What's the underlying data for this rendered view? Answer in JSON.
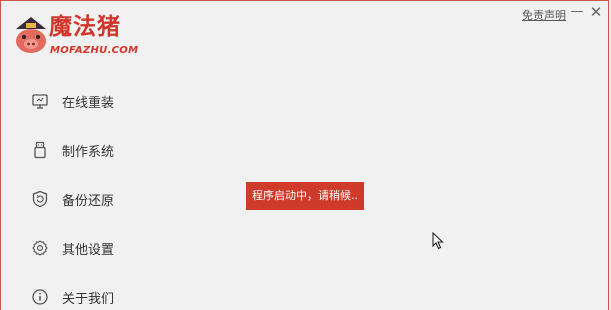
{
  "window": {
    "disclaimer_label": "免责声明",
    "minimize_glyph": "—",
    "close_glyph": "✕"
  },
  "logo": {
    "title": "魔法猪",
    "subtitle": "MOFAZHU.COM"
  },
  "sidebar": {
    "items": [
      {
        "label": "在线重装",
        "icon": "monitor-icon"
      },
      {
        "label": "制作系统",
        "icon": "usb-drive-icon"
      },
      {
        "label": "备份还原",
        "icon": "shield-refresh-icon"
      },
      {
        "label": "其他设置",
        "icon": "gear-icon"
      },
      {
        "label": "关于我们",
        "icon": "info-icon"
      }
    ]
  },
  "toast": {
    "message": "程序启动中，请稍候.."
  },
  "colors": {
    "brand_red": "#d2352a",
    "toast_bg": "#d03a2b",
    "background": "#f2f1f1"
  }
}
